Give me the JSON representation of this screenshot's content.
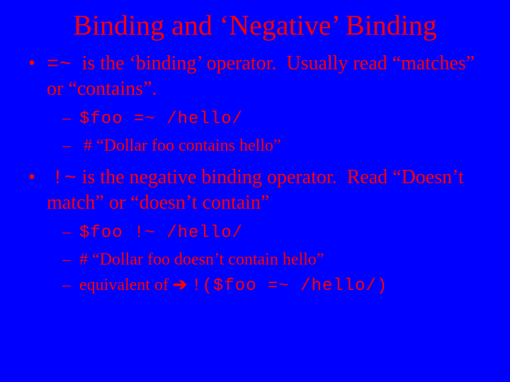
{
  "title": "Binding and ‘Negative’ Binding",
  "bullets": [
    {
      "text_html": "<span class=\"mono\">=~</span>  is the ‘binding’ operator.  Usually read “matches” or “contains”.",
      "sub": [
        {
          "text_html": "<span class=\"mono\">$foo =~ /hello/</span>"
        },
        {
          "text_html": " # “Dollar foo contains hello”"
        }
      ]
    },
    {
      "text_html": " <span class=\"mono\">!~</span> is the negative binding operator.  Read “Doesn’t match” or “doesn’t contain”",
      "sub": [
        {
          "text_html": "<span class=\"mono\">$foo !~ /hello/</span>"
        },
        {
          "text_html": "# “Dollar foo doesn’t contain hello”"
        },
        {
          "text_html": "equivalent of <span class=\"arrow\">➔</span> <span class=\"mono\">!($foo =~ /hello/)</span>"
        }
      ]
    }
  ]
}
